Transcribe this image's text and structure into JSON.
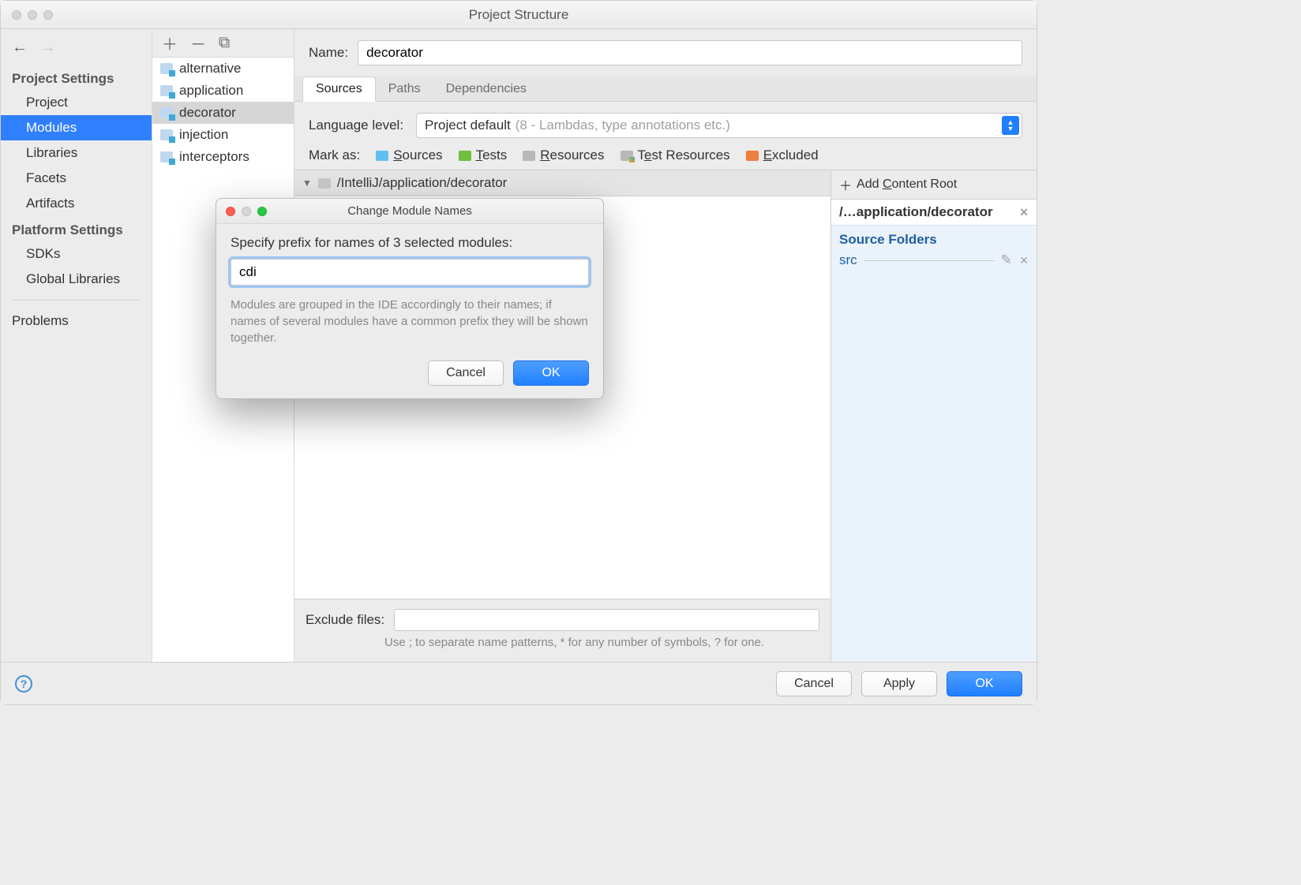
{
  "window": {
    "title": "Project Structure"
  },
  "sidebar": {
    "heading1": "Project Settings",
    "heading2": "Platform Settings",
    "items1": [
      "Project",
      "Modules",
      "Libraries",
      "Facets",
      "Artifacts"
    ],
    "items2": [
      "SDKs",
      "Global Libraries"
    ],
    "problems": "Problems",
    "selected": "Modules"
  },
  "modules": {
    "items": [
      "alternative",
      "application",
      "decorator",
      "injection",
      "interceptors"
    ],
    "selected": "decorator"
  },
  "name": {
    "label": "Name:",
    "value": "decorator"
  },
  "tabs": {
    "items": [
      "Sources",
      "Paths",
      "Dependencies"
    ],
    "active": "Sources"
  },
  "language": {
    "label": "Language level:",
    "value": "Project default",
    "hint": "(8 - Lambdas, type annotations etc.)"
  },
  "mark": {
    "label": "Mark as:",
    "items": [
      "Sources",
      "Tests",
      "Resources",
      "Test Resources",
      "Excluded"
    ]
  },
  "tree": {
    "path": "/IntelliJ/application/decorator"
  },
  "exclude": {
    "label": "Exclude files:",
    "hint": "Use ; to separate name patterns, * for any number of symbols, ? for one."
  },
  "rightcol": {
    "add": "Add Content Root",
    "path": "/…application/decorator",
    "sf": "Source Folders",
    "src": "src"
  },
  "footer": {
    "cancel": "Cancel",
    "apply": "Apply",
    "ok": "OK"
  },
  "modal": {
    "title": "Change Module Names",
    "label": "Specify prefix for names of 3 selected modules:",
    "value": "cdi",
    "hint": "Modules are grouped in the IDE accordingly to their names; if names of several modules have a common prefix they will be shown together.",
    "cancel": "Cancel",
    "ok": "OK"
  }
}
